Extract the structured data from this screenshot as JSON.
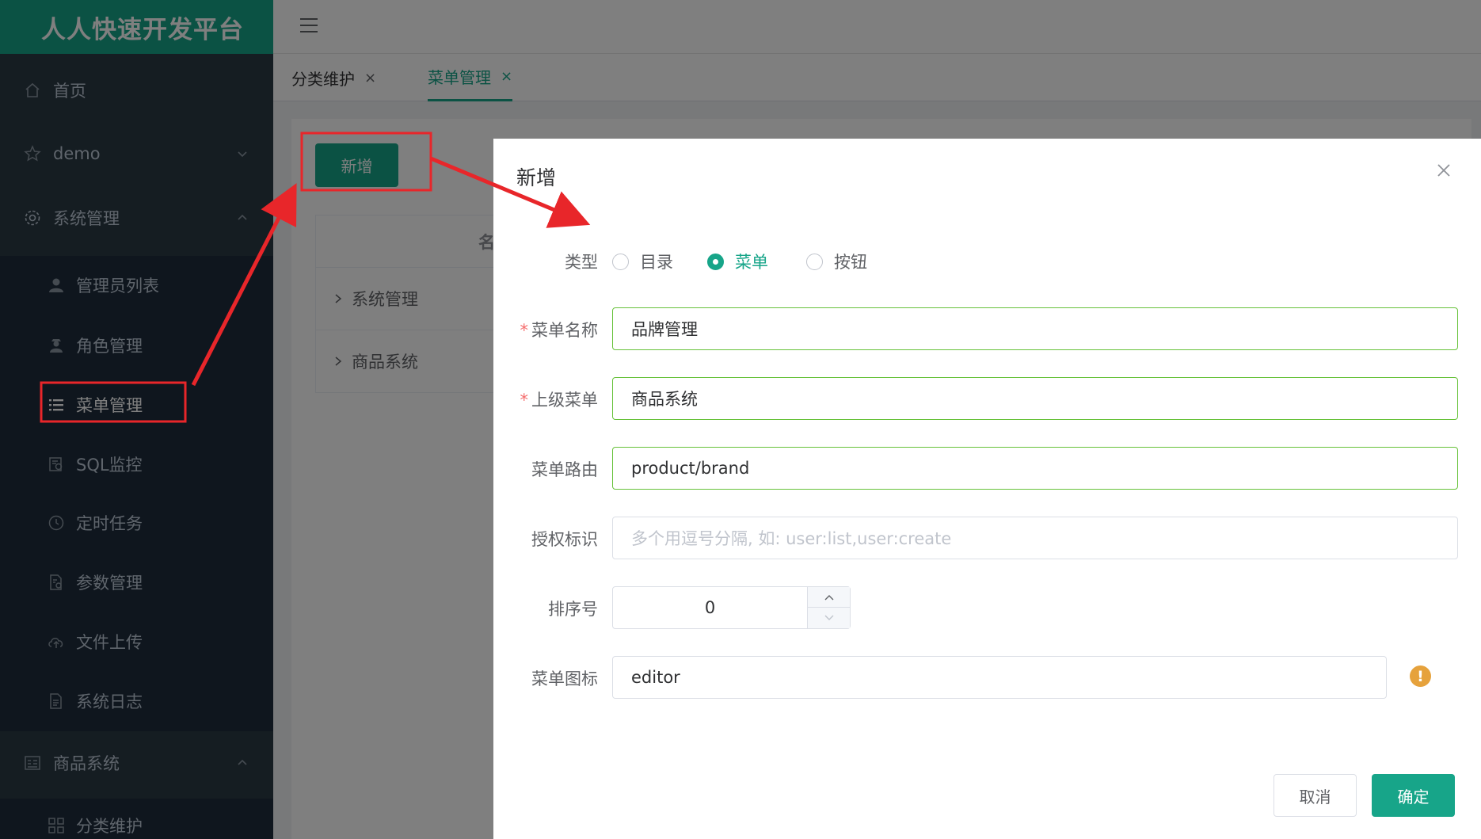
{
  "app": {
    "brand": "人人快速开发平台"
  },
  "sidebar": {
    "items": [
      {
        "label": "首页",
        "icon": "home-icon"
      },
      {
        "label": "demo",
        "icon": "star-icon"
      },
      {
        "label": "系统管理",
        "icon": "gear-icon"
      },
      {
        "label": "管理员列表",
        "icon": "user-icon"
      },
      {
        "label": "角色管理",
        "icon": "role-icon"
      },
      {
        "label": "菜单管理",
        "icon": "list-icon"
      },
      {
        "label": "SQL监控",
        "icon": "monitor-icon"
      },
      {
        "label": "定时任务",
        "icon": "clock-icon"
      },
      {
        "label": "参数管理",
        "icon": "params-icon"
      },
      {
        "label": "文件上传",
        "icon": "cloud-upload-icon"
      },
      {
        "label": "系统日志",
        "icon": "log-icon"
      },
      {
        "label": "商品系统",
        "icon": "product-icon"
      },
      {
        "label": "分类维护",
        "icon": "category-icon"
      }
    ]
  },
  "tabs": [
    {
      "label": "分类维护",
      "close": "×"
    },
    {
      "label": "菜单管理",
      "close": "×"
    }
  ],
  "content": {
    "add_button": "新增",
    "table_header_partial": "名",
    "rows": [
      "系统管理",
      "商品系统"
    ]
  },
  "dialog": {
    "title": "新增",
    "type_label": "类型",
    "type_options": [
      "目录",
      "菜单",
      "按钮"
    ],
    "type_selected": "菜单",
    "required_mark": "*",
    "fields": {
      "name": {
        "label": "菜单名称",
        "value": "品牌管理"
      },
      "parent": {
        "label": "上级菜单",
        "value": "商品系统"
      },
      "url": {
        "label": "菜单路由",
        "value": "product/brand"
      },
      "perms": {
        "label": "授权标识",
        "placeholder": "多个用逗号分隔, 如: user:list,user:create"
      },
      "order": {
        "label": "排序号",
        "value": "0"
      },
      "icon": {
        "label": "菜单图标",
        "value": "editor"
      }
    },
    "warning_icon_glyph": "!",
    "cancel": "取消",
    "confirm": "确定"
  },
  "colors": {
    "accent": "#17a589",
    "sidebar_bg": "#2b3a44",
    "valid_border": "#67c23a",
    "warning": "#e6a23c",
    "annotation": "#e8262a"
  }
}
